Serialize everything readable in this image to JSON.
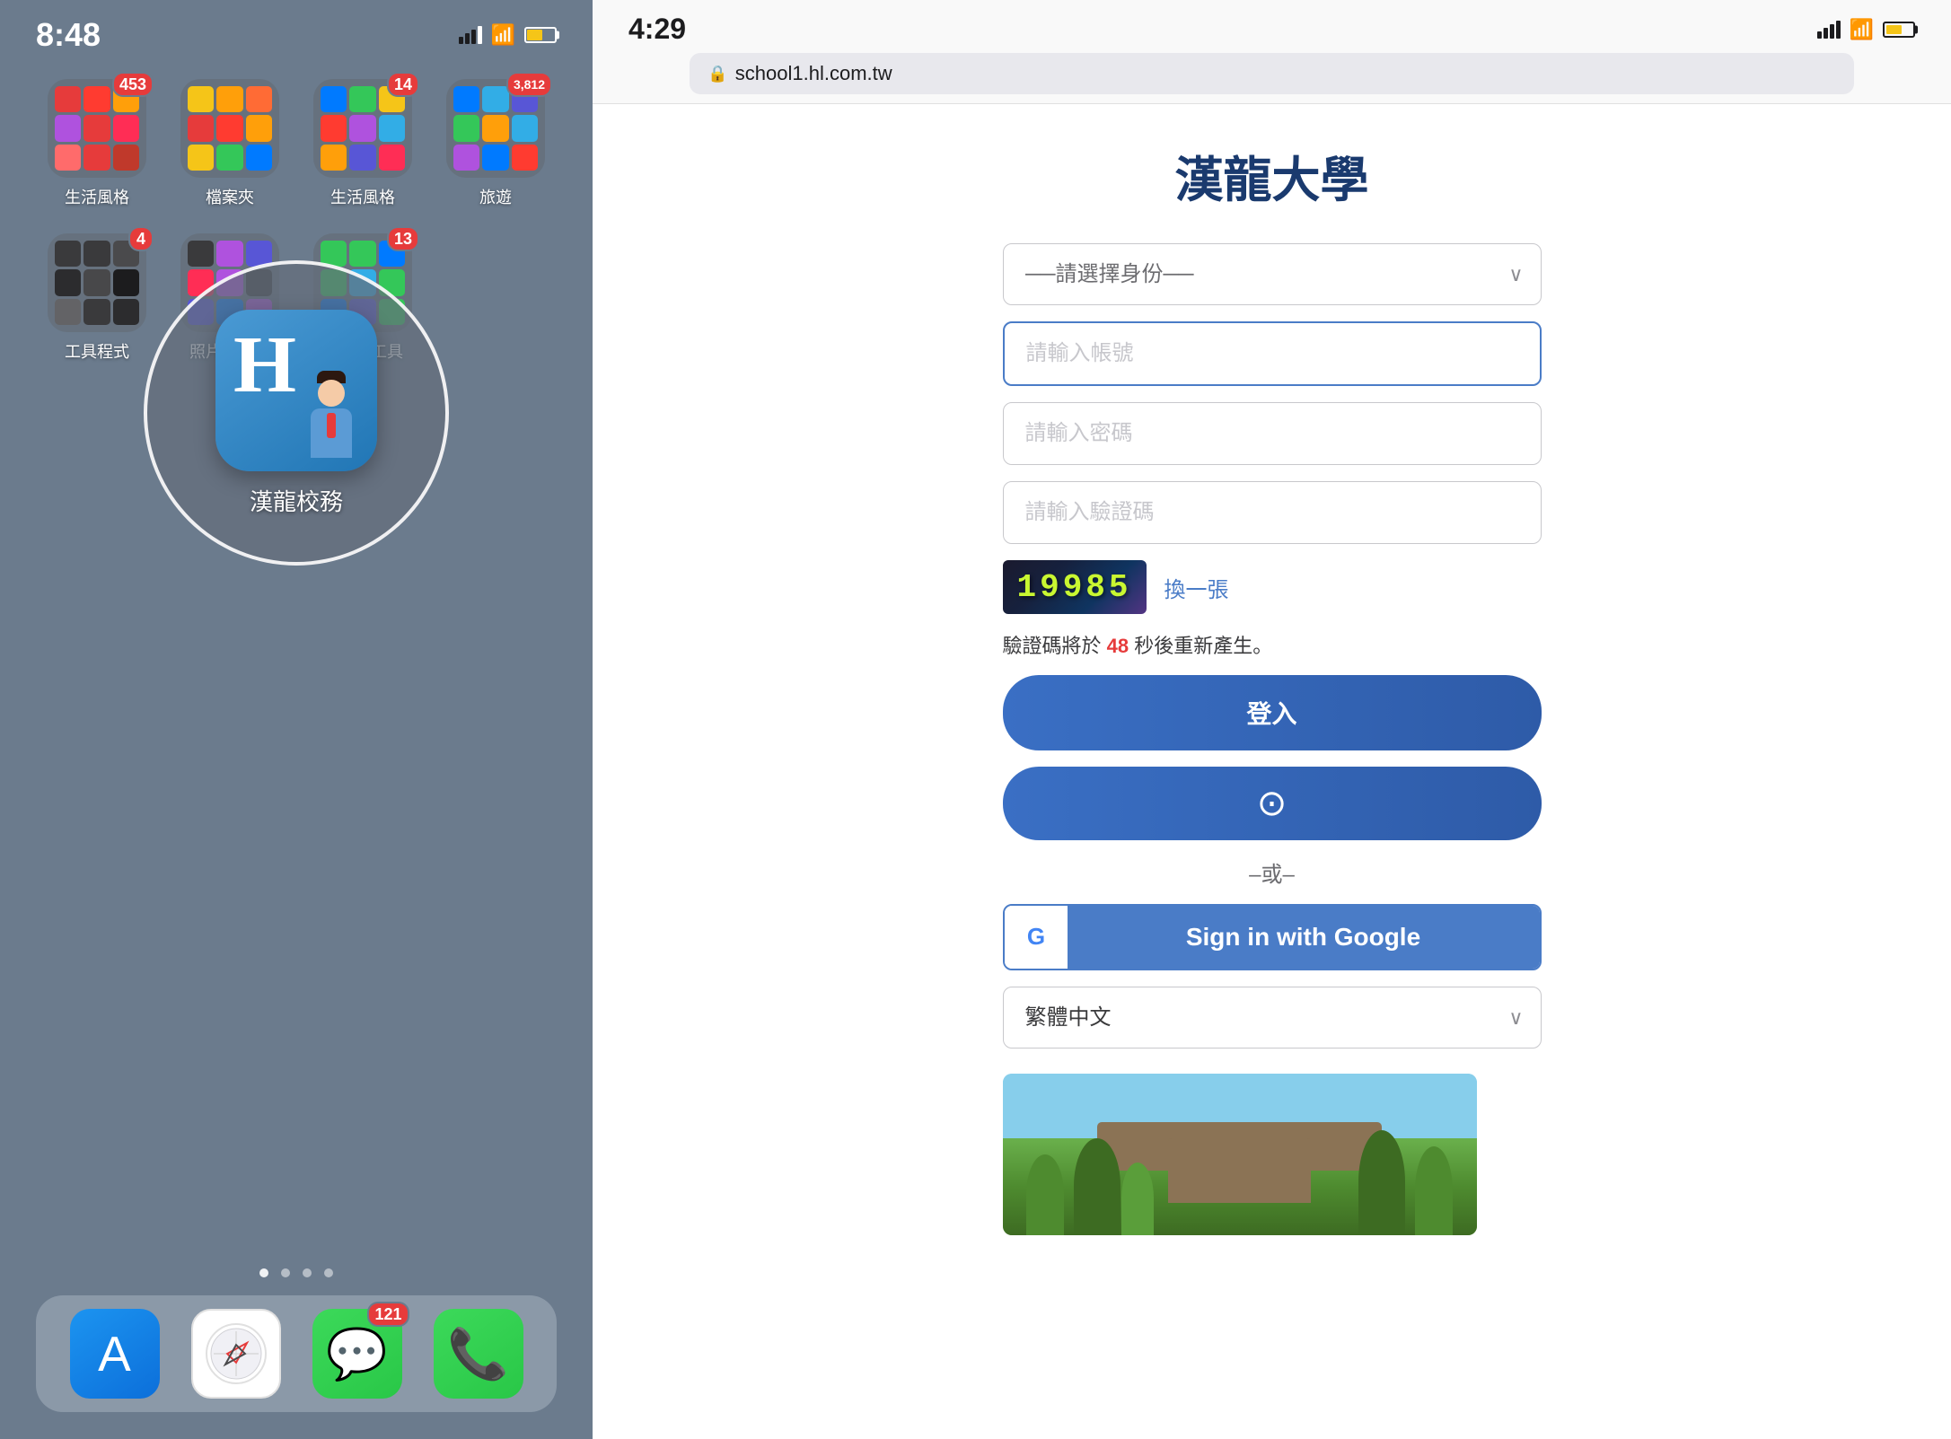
{
  "left_phone": {
    "status_time": "8:48",
    "status_icons": "████ ▲ 🔋",
    "folders": [
      {
        "label": "生活風格",
        "badge": "453",
        "has_badge": true
      },
      {
        "label": "檔案夾",
        "badge": "",
        "has_badge": false
      },
      {
        "label": "生活風格",
        "badge": "14",
        "has_badge": true
      },
      {
        "label": "旅遊",
        "badge": "3,812",
        "has_badge": true
      },
      {
        "label": "工具程式",
        "badge": "4",
        "has_badge": true
      },
      {
        "label": "照片和影片",
        "badge": "",
        "has_badge": false
      },
      {
        "label": "生產力工具",
        "badge": "13",
        "has_badge": true
      }
    ],
    "highlight_app_label": "漢龍校務",
    "page_dots": 4,
    "active_dot": 0,
    "dock_apps": [
      "App Store",
      "Safari",
      "Messages",
      "Phone"
    ]
  },
  "right_browser": {
    "status_time": "4:29",
    "url": "school1.hl.com.tw",
    "page_title": "漢龍大學",
    "select_placeholder": "──請選擇身份──",
    "username_placeholder": "請輸入帳號",
    "password_placeholder": "請輸入密碼",
    "captcha_placeholder": "請輸入驗證碼",
    "captcha_text": "19985",
    "refresh_label": "換一張",
    "timer_text_prefix": "驗證碼將於",
    "timer_seconds": "48",
    "timer_text_suffix": "秒後重新產生。",
    "login_button_label": "登入",
    "biometric_icon": "◎",
    "or_label": "–或–",
    "google_button_label": "Sign in with Google",
    "language_select": "繁體中文"
  }
}
